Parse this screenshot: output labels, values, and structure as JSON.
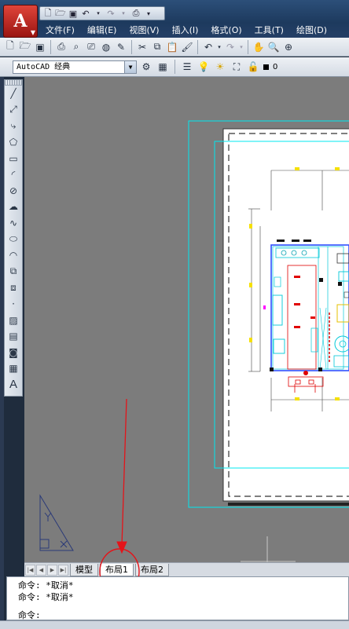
{
  "app": {
    "logo_letter": "A",
    "menus": [
      {
        "label": "文件(F)"
      },
      {
        "label": "编辑(E)"
      },
      {
        "label": "视图(V)"
      },
      {
        "label": "插入(I)"
      },
      {
        "label": "格式(O)"
      },
      {
        "label": "工具(T)"
      },
      {
        "label": "绘图(D)"
      }
    ]
  },
  "toolbar2": {
    "workspace": "AutoCAD 经典",
    "layer_value": "0"
  },
  "tabs": [
    {
      "label": "模型"
    },
    {
      "label": "布局1"
    },
    {
      "label": "布局2"
    }
  ],
  "command": {
    "history": [
      "命令: *取消*",
      "命令: *取消*"
    ],
    "prompt": "命令:"
  },
  "canvas": {
    "background_color": "#7c7c7c",
    "viewport_color": "#00ffff"
  }
}
